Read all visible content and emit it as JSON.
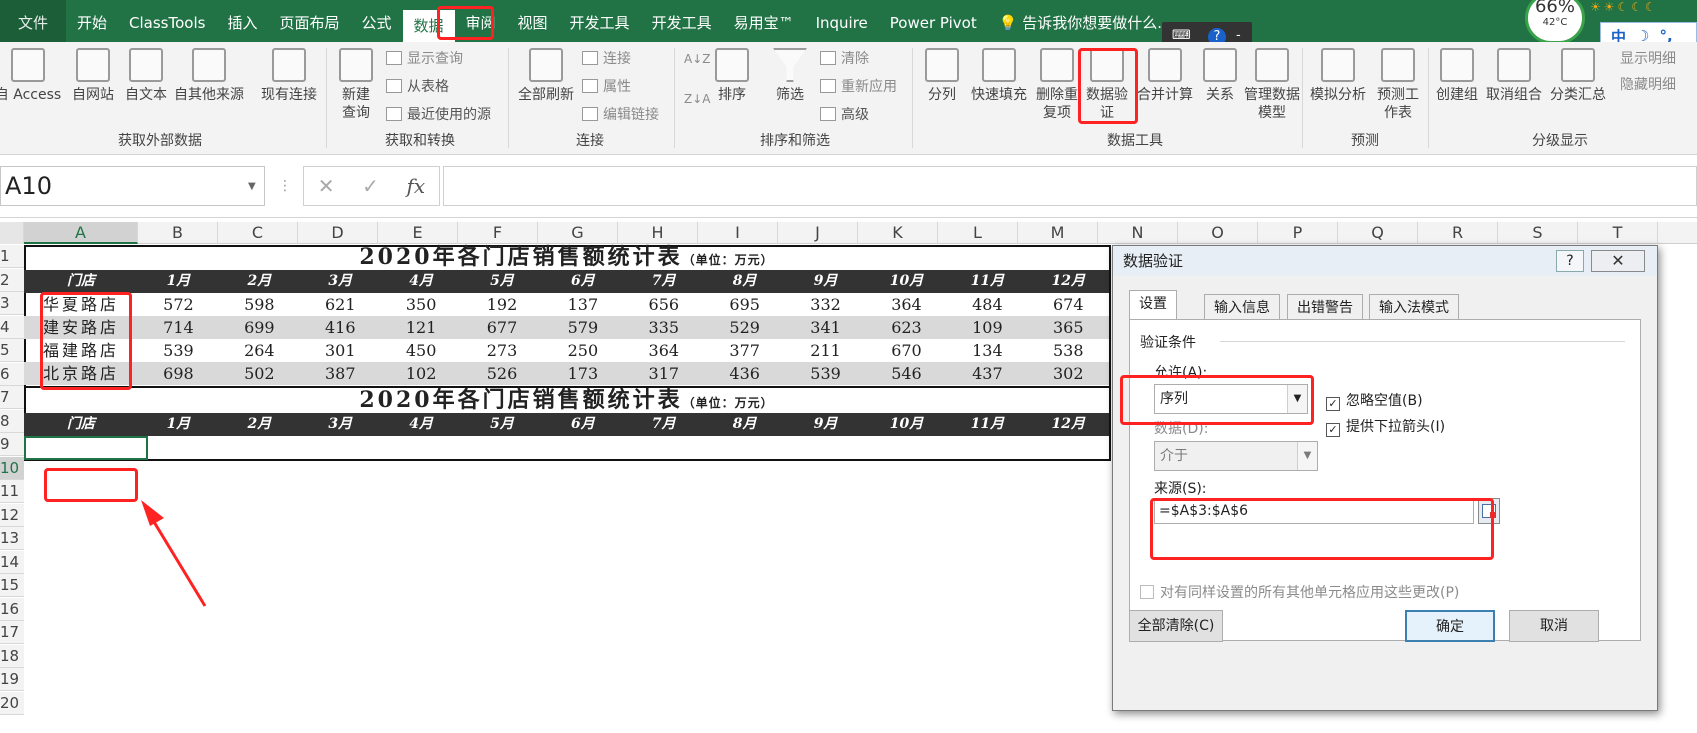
{
  "tabs": [
    "文件",
    "开始",
    "ClassTools",
    "插入",
    "页面布局",
    "公式",
    "数据",
    "审阅",
    "视图",
    "开发工具",
    "开发工具",
    "易用宝™",
    "Inquire",
    "Power Pivot",
    "告诉我你想要做什么..."
  ],
  "active_tab": "数据",
  "status": {
    "battery_pct": "66%",
    "temp": "42°C",
    "ime": [
      "中",
      "☽",
      "°,"
    ]
  },
  "ribbon": {
    "get_external": {
      "buttons": [
        "自 Access",
        "自网站",
        "自文本",
        "自其他来源",
        "现有连接"
      ],
      "label": "获取外部数据"
    },
    "transform": {
      "new_query": [
        "新建",
        "查询"
      ],
      "items": [
        "显示查询",
        "从表格",
        "最近使用的源"
      ],
      "label": "获取和转换"
    },
    "connections": {
      "refresh": "全部刷新",
      "items": [
        "连接",
        "属性",
        "编辑链接"
      ],
      "label": "连接"
    },
    "sort": {
      "sort": "排序",
      "filter": "筛选",
      "items": [
        "清除",
        "重新应用",
        "高级"
      ],
      "label": "排序和筛选"
    },
    "tools": {
      "buttons": [
        "分列",
        "快速填充",
        "删除重复项",
        "数据验证",
        "合并计算",
        "关系",
        "管理数据模型"
      ],
      "label": "数据工具"
    },
    "forecast": {
      "buttons": [
        "模拟分析",
        "预测工作表"
      ],
      "label": "预测"
    },
    "outline": {
      "buttons": [
        "创建组",
        "取消组合",
        "分类汇总"
      ],
      "items": [
        "显示明细",
        "隐藏明细"
      ],
      "label": "分级显示"
    }
  },
  "formula_bar": {
    "name_box": "A10",
    "fx": "fx",
    "formula": ""
  },
  "columns": [
    "A",
    "B",
    "C",
    "D",
    "E",
    "F",
    "G",
    "H",
    "I",
    "J",
    "K",
    "L",
    "M",
    "N",
    "O",
    "P",
    "Q",
    "R",
    "S",
    "T"
  ],
  "rows": [
    "1",
    "2",
    "3",
    "4",
    "5",
    "6",
    "7",
    "8",
    "9",
    "10",
    "11",
    "12",
    "13",
    "14",
    "15",
    "16",
    "17",
    "18",
    "19",
    "20"
  ],
  "sheet": {
    "title": "2020年各门店销售额统计表",
    "unit": "（单位：万元）",
    "headers": [
      "门店",
      "1月",
      "2月",
      "3月",
      "4月",
      "5月",
      "6月",
      "7月",
      "8月",
      "9月",
      "10月",
      "11月",
      "12月"
    ],
    "data": [
      [
        "华夏路店",
        "572",
        "598",
        "621",
        "350",
        "192",
        "137",
        "656",
        "695",
        "332",
        "364",
        "484",
        "674"
      ],
      [
        "建安路店",
        "714",
        "699",
        "416",
        "121",
        "677",
        "579",
        "335",
        "529",
        "341",
        "623",
        "109",
        "365"
      ],
      [
        "福建路店",
        "539",
        "264",
        "301",
        "450",
        "273",
        "250",
        "364",
        "377",
        "211",
        "670",
        "134",
        "538"
      ],
      [
        "北京路店",
        "698",
        "502",
        "387",
        "102",
        "526",
        "173",
        "317",
        "436",
        "539",
        "546",
        "437",
        "302"
      ]
    ],
    "title2": "2020年各门店销售额统计表",
    "unit2": "（单位：万元）"
  },
  "dialog": {
    "title": "数据验证",
    "help": "?",
    "close": "✕",
    "tabs": [
      "设置",
      "输入信息",
      "出错警告",
      "输入法模式"
    ],
    "section": "验证条件",
    "allow_label": "允许(A):",
    "allow_value": "序列",
    "ignore_blank": "忽略空值(B)",
    "dropdown": "提供下拉箭头(I)",
    "data_label": "数据(D):",
    "data_value": "介于",
    "source_label": "来源(S):",
    "source_value": "=$A$3:$A$6",
    "apply_all": "对有同样设置的所有其他单元格应用这些更改(P)",
    "clear_all": "全部清除(C)",
    "ok": "确定",
    "cancel": "取消"
  }
}
